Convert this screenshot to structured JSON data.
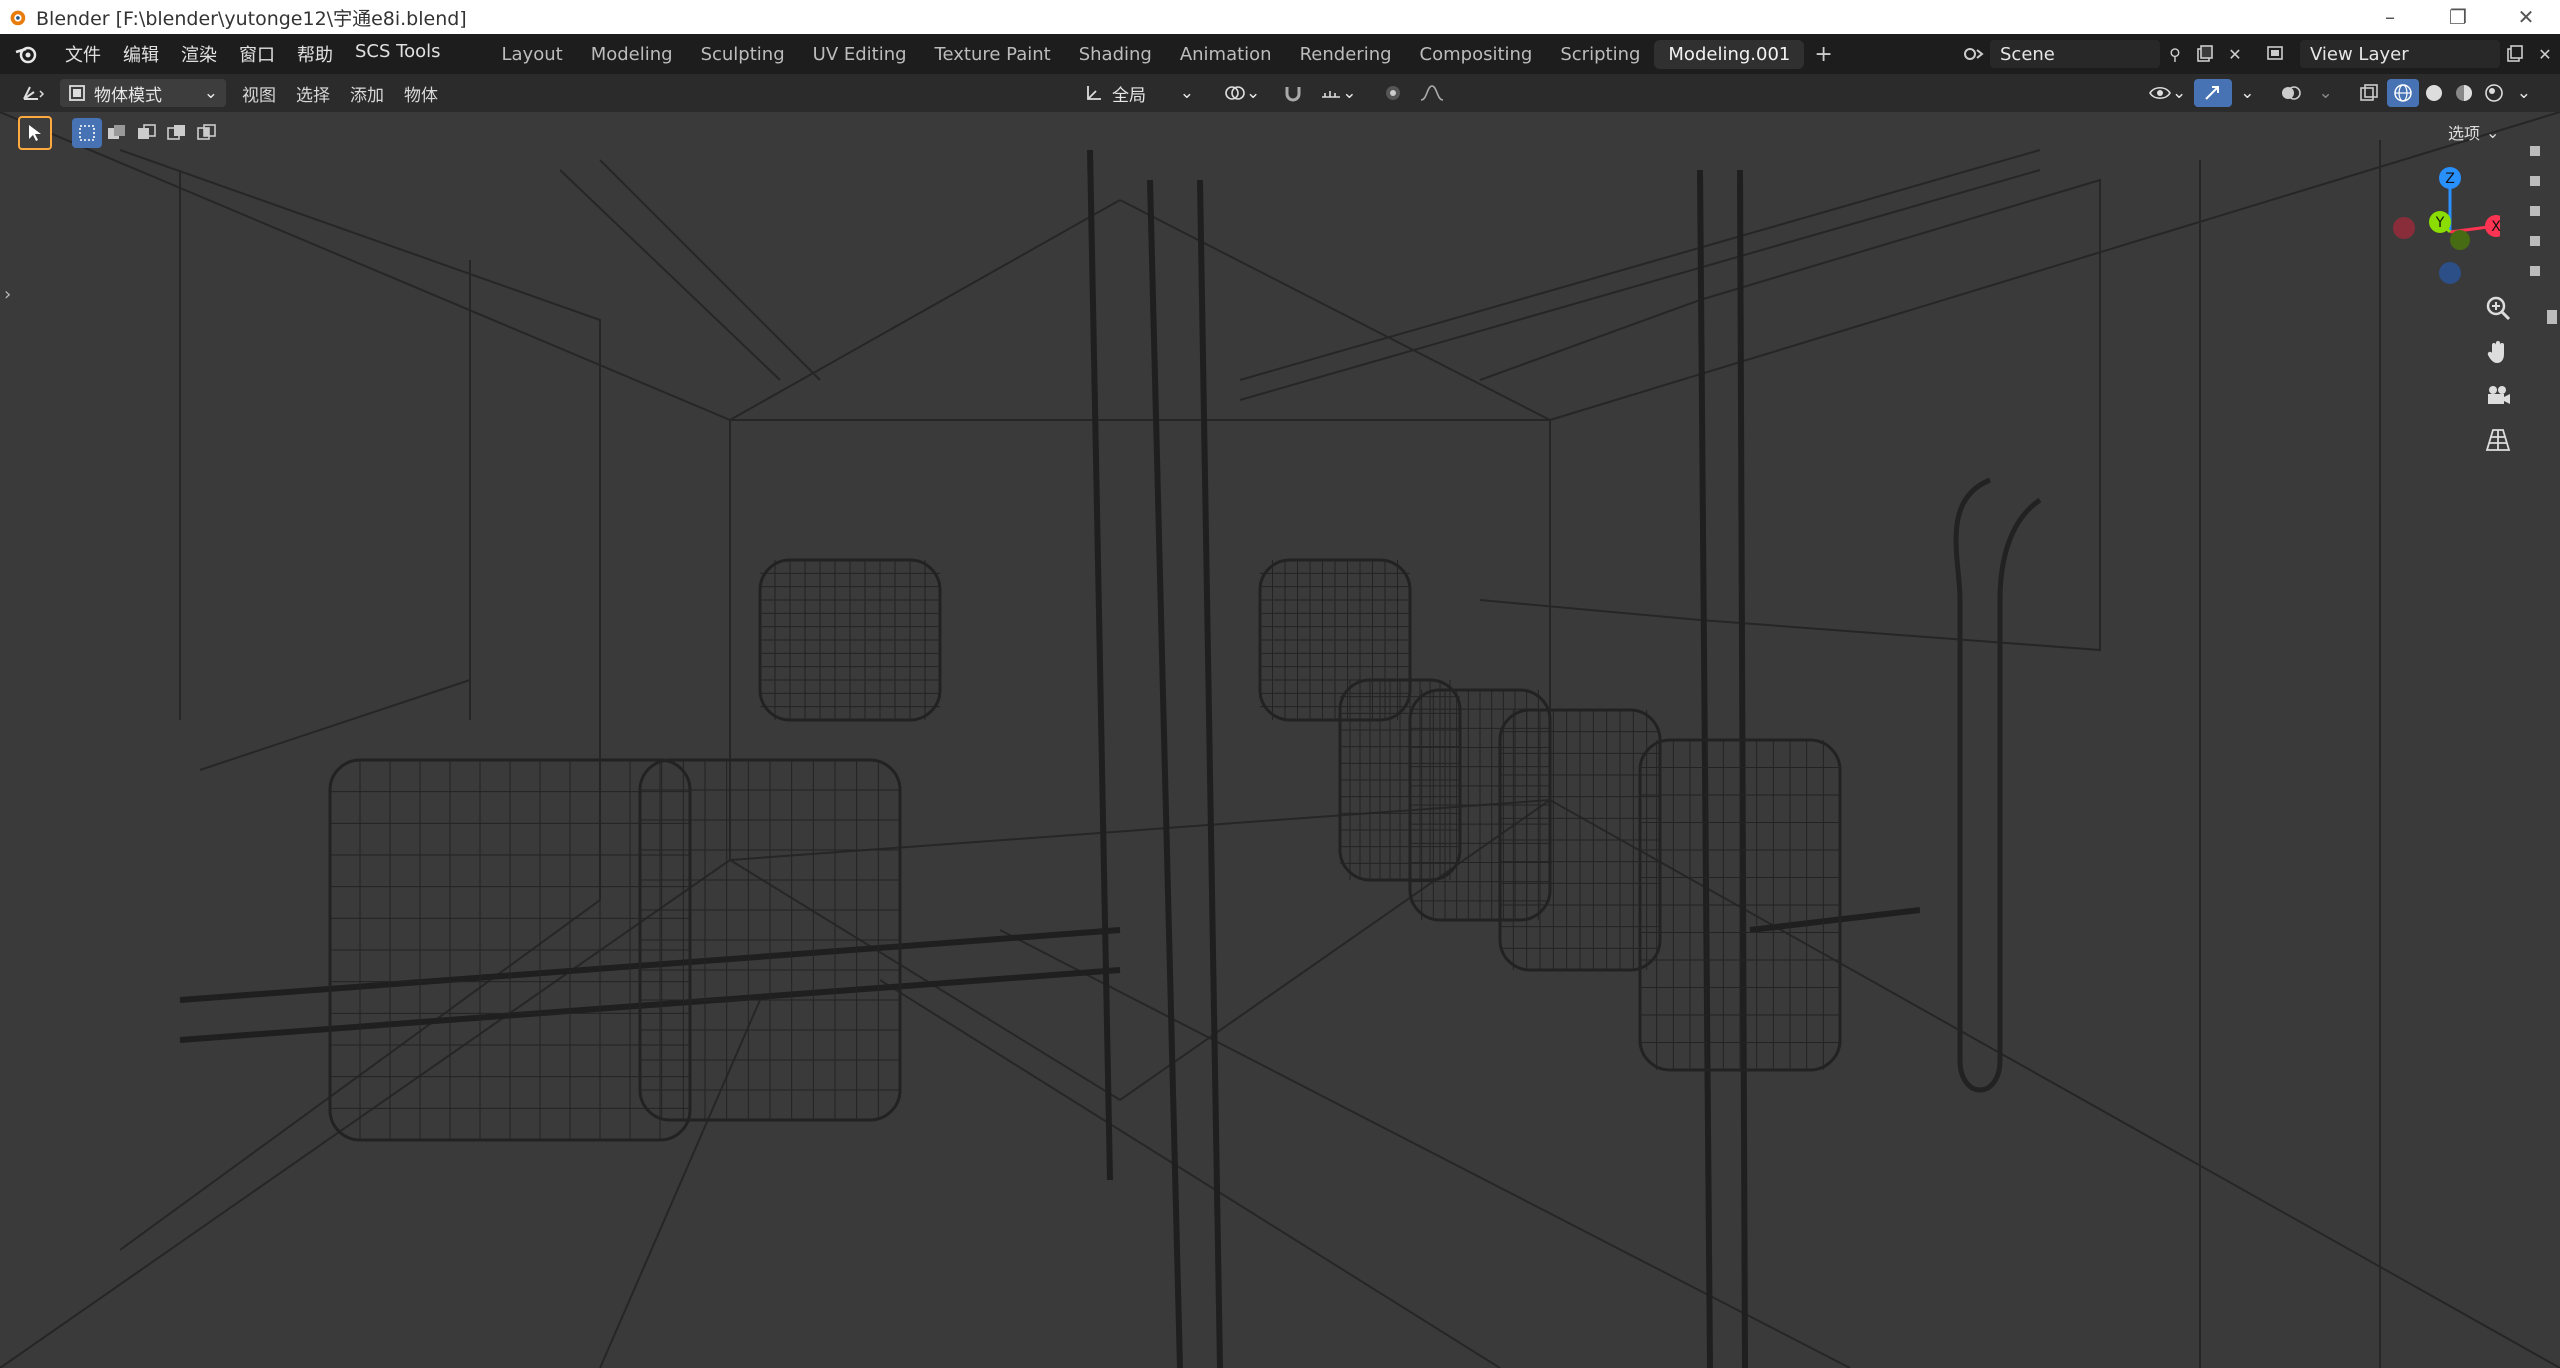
{
  "window": {
    "title": "Blender [F:\\blender\\yutonge12\\宇通e8i.blend]",
    "controls": {
      "minimize": "–",
      "maximize": "❐",
      "close": "✕"
    }
  },
  "topbar": {
    "menu": [
      "文件",
      "编辑",
      "渲染",
      "窗口",
      "帮助",
      "SCS Tools"
    ],
    "tabs": [
      {
        "label": "Layout",
        "active": false
      },
      {
        "label": "Modeling",
        "active": false
      },
      {
        "label": "Sculpting",
        "active": false
      },
      {
        "label": "UV Editing",
        "active": false
      },
      {
        "label": "Texture Paint",
        "active": false
      },
      {
        "label": "Shading",
        "active": false
      },
      {
        "label": "Animation",
        "active": false
      },
      {
        "label": "Rendering",
        "active": false
      },
      {
        "label": "Compositing",
        "active": false
      },
      {
        "label": "Scripting",
        "active": false
      },
      {
        "label": "Modeling.001",
        "active": true
      }
    ],
    "add_tab": "+",
    "scene": "Scene",
    "view_layer": "View Layer"
  },
  "viewport_header": {
    "mode": "物体模式",
    "menu": [
      "视图",
      "选择",
      "添加",
      "物体"
    ],
    "transform_orientation": "全局"
  },
  "viewport": {
    "options_label": "选项",
    "gizmo": {
      "z": "Z",
      "y": "Y",
      "x": "X"
    },
    "shading_mode": "wireframe"
  },
  "colors": {
    "accent_blue": "#4772b3",
    "axis_x": "#ff3352",
    "axis_y": "#8bdc00",
    "axis_z": "#2890ff",
    "select_orange": "#ffaa40"
  }
}
